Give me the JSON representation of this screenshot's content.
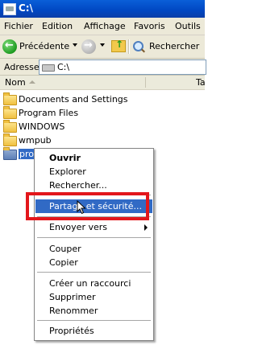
{
  "window": {
    "title": "C:\\"
  },
  "menu": [
    "Fichier",
    "Edition",
    "Affichage",
    "Favoris",
    "Outils"
  ],
  "toolbar": {
    "back_label": "Précédente",
    "search_label": "Rechercher"
  },
  "address": {
    "label": "Adresse",
    "value": "C:\\"
  },
  "columns": {
    "name": "Nom",
    "size": "Ta"
  },
  "files": [
    "Documents and Settings",
    "Program Files",
    "WINDOWS",
    "wmpub",
    "pro"
  ],
  "context_menu": [
    "Ouvrir",
    "Explorer",
    "Rechercher...",
    "Partage et sécurité...",
    "Envoyer vers",
    "Couper",
    "Copier",
    "Créer un raccourci",
    "Supprimer",
    "Renommer",
    "Propriétés"
  ],
  "colors": {
    "titlebar": "#0a5fd8",
    "selection": "#316ac5",
    "annotation": "#e3161b"
  }
}
